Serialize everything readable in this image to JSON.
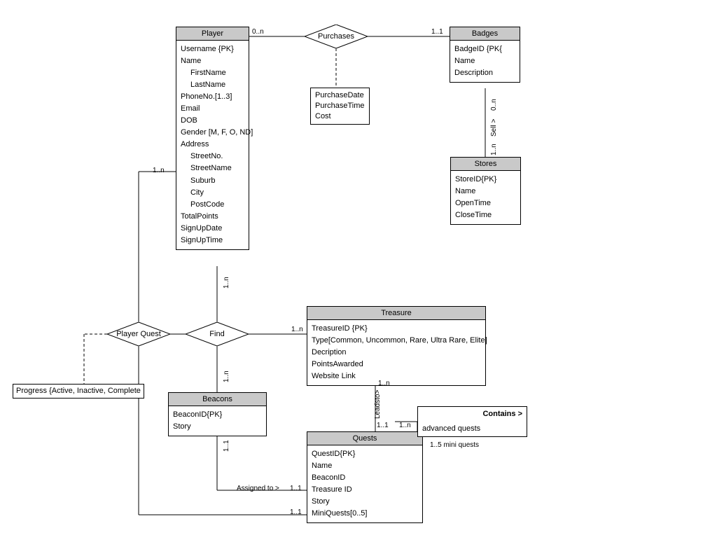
{
  "entities": {
    "player": {
      "title": "Player",
      "attrs": [
        "Username {PK}",
        "Name",
        "FirstName",
        "LastName",
        "PhoneNo.[1..3]",
        "Email",
        "DOB",
        "Gender [M, F, O, ND]",
        "Address",
        "StreetNo.",
        "StreetName",
        "Suburb",
        "City",
        "PostCode",
        "TotalPoints",
        "SignUpDate",
        "SignUpTime"
      ]
    },
    "badges": {
      "title": "Badges",
      "attrs": [
        "BadgeID {PK{",
        "Name",
        "Description"
      ]
    },
    "stores": {
      "title": "Stores",
      "attrs": [
        "StoreID{PK}",
        "Name",
        "OpenTime",
        "CloseTime"
      ]
    },
    "treasure": {
      "title": "Treasure",
      "attrs": [
        "TreasureID {PK}",
        "Type[Common, Uncommon, Rare, Ultra Rare, Elite]",
        "Decription",
        "PointsAwarded",
        "Website Link"
      ]
    },
    "beacons": {
      "title": "Beacons",
      "attrs": [
        "BeaconID{PK}",
        "Story"
      ]
    },
    "quests": {
      "title": "Quests",
      "attrs": [
        "QuestID{PK}",
        "Name",
        "BeaconID",
        "Treasure ID",
        "Story",
        "MiniQuests[0..5]"
      ]
    }
  },
  "relationships": {
    "purchases": "Purchases",
    "find": "Find",
    "playerquest": "Player Quest"
  },
  "attrboxes": {
    "purchase": [
      "PurchaseDate",
      "PurchaseTime",
      "Cost"
    ],
    "progress": "Progress {Active, Inactive, Complete",
    "contains": {
      "title": "Contains >",
      "adv": "advanced quests",
      "mini": "1..5 mini quests"
    }
  },
  "cardinalities": {
    "p_purch": "0..n",
    "purch_b": "1..1",
    "b_sell_top": "0..n",
    "sell_label": "Sell >",
    "b_sell_bot": "1..n",
    "player_find": "1..n",
    "find_treasure": "1..n",
    "find_beacons": "1..n",
    "beacons_find": "1..1",
    "treasure_leads": "1..n",
    "leads_label": "Leadsto>",
    "leads_q": "1..1",
    "contains_left": "1..n",
    "assigned": "Assigned to >",
    "assigned_r": "1..1",
    "pq_player": "1..n",
    "pq_quest": "1..1"
  }
}
